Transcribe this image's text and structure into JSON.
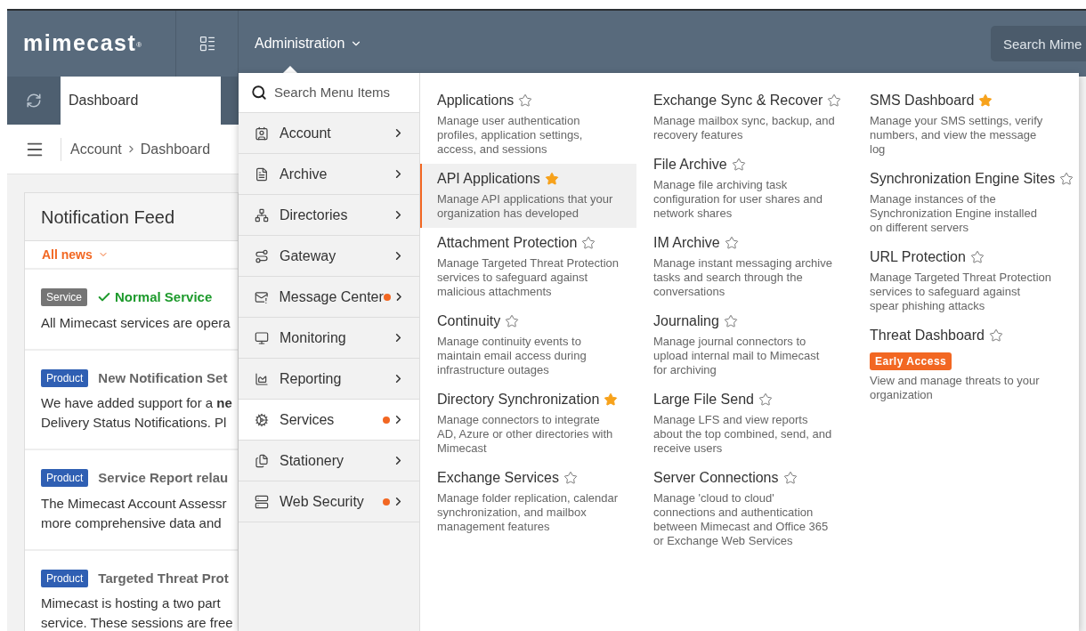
{
  "header": {
    "logo": "mimecast",
    "logo_mark": "®",
    "admin_menu": "Administration",
    "search": {
      "placeholder": "Search Mime"
    }
  },
  "tab": {
    "label": "Dashboard"
  },
  "breadcrumb": [
    "Account",
    "Dashboard"
  ],
  "feed": {
    "title": "Notification Feed",
    "filter": "All news",
    "items": [
      {
        "tag": "Service",
        "color": "#757575",
        "title": "Normal Service",
        "ok": true,
        "lines": [
          "All Mimecast services are opera"
        ]
      },
      {
        "tag": "Product",
        "color": "#2f5fb3",
        "title": "New Notification Set",
        "ok": false,
        "lines": [
          "We have added support for a **ne**",
          "Delivery Status Notifications. Pl"
        ]
      },
      {
        "tag": "Product",
        "color": "#2f5fb3",
        "title": "Service Report relau",
        "ok": false,
        "lines": [
          "The Mimecast Account Assessr",
          "more comprehensive data and"
        ]
      },
      {
        "tag": "Product",
        "color": "#2f5fb3",
        "title": "Targeted Threat Prot",
        "ok": false,
        "lines": [
          "Mimecast is hosting a two part",
          "service. These sessions are free"
        ]
      }
    ]
  },
  "menu": {
    "search": {
      "placeholder": "Search Menu Items"
    },
    "items": [
      {
        "label": "Account",
        "dot": false,
        "selected": false
      },
      {
        "label": "Archive",
        "dot": false,
        "selected": false
      },
      {
        "label": "Directories",
        "dot": false,
        "selected": false
      },
      {
        "label": "Gateway",
        "dot": false,
        "selected": false
      },
      {
        "label": "Message Center",
        "dot": true,
        "selected": false
      },
      {
        "label": "Monitoring",
        "dot": false,
        "selected": false
      },
      {
        "label": "Reporting",
        "dot": false,
        "selected": false
      },
      {
        "label": "Services",
        "dot": true,
        "selected": true
      },
      {
        "label": "Stationery",
        "dot": false,
        "selected": false
      },
      {
        "label": "Web Security",
        "dot": true,
        "selected": false
      }
    ],
    "columns": [
      [
        {
          "title": "Applications",
          "starred": false,
          "selected": false,
          "desc": "Manage user authentication profiles, application settings, access, and sessions"
        },
        {
          "title": "API Applications",
          "starred": true,
          "selected": true,
          "desc": "Manage API applications that your organization has developed"
        },
        {
          "title": "Attachment Protection",
          "starred": false,
          "selected": false,
          "desc": "Manage Targeted Threat Protection services to safeguard against malicious attachments"
        },
        {
          "title": "Continuity",
          "starred": false,
          "selected": false,
          "desc": "Manage continuity events to maintain email access during infrastructure outages"
        },
        {
          "title": "Directory Synchronization",
          "starred": true,
          "selected": false,
          "desc": "Manage connectors to integrate AD, Azure or other directories with Mimecast"
        },
        {
          "title": "Exchange Services",
          "starred": false,
          "selected": false,
          "desc": "Manage folder replication, calendar synchronization, and mailbox management features"
        }
      ],
      [
        {
          "title": "Exchange Sync & Recover",
          "starred": false,
          "selected": false,
          "desc": "Manage mailbox sync, backup, and recovery features"
        },
        {
          "title": "File Archive",
          "starred": false,
          "selected": false,
          "desc": "Manage file archiving task configuration for user shares and network shares"
        },
        {
          "title": "IM Archive",
          "starred": false,
          "selected": false,
          "desc": "Manage instant messaging archive tasks and search through the conversations"
        },
        {
          "title": "Journaling",
          "starred": false,
          "selected": false,
          "desc": "Manage journal connectors to upload internal mail to Mimecast for archiving"
        },
        {
          "title": "Large File Send",
          "starred": false,
          "selected": false,
          "desc": "Manage LFS and view reports about the top combined, send, and receive users"
        },
        {
          "title": "Server Connections",
          "starred": false,
          "selected": false,
          "desc": "Manage 'cloud to cloud' connections and authentication between Mimecast and Office 365 or Exchange Web Services"
        }
      ],
      [
        {
          "title": "SMS Dashboard",
          "starred": true,
          "selected": false,
          "desc": "Manage your SMS settings, verify numbers, and view the message log"
        },
        {
          "title": "Synchronization Engine Sites",
          "starred": false,
          "selected": false,
          "desc": "Manage instances of the Synchronization Engine installed on different servers"
        },
        {
          "title": "URL Protection",
          "starred": false,
          "selected": false,
          "desc": "Manage Targeted Threat Protection services to safeguard against spear phishing attacks"
        },
        {
          "title": "Threat Dashboard",
          "starred": false,
          "selected": false,
          "badge": "Early Access",
          "desc": "View and manage threats to your organization"
        }
      ]
    ]
  }
}
